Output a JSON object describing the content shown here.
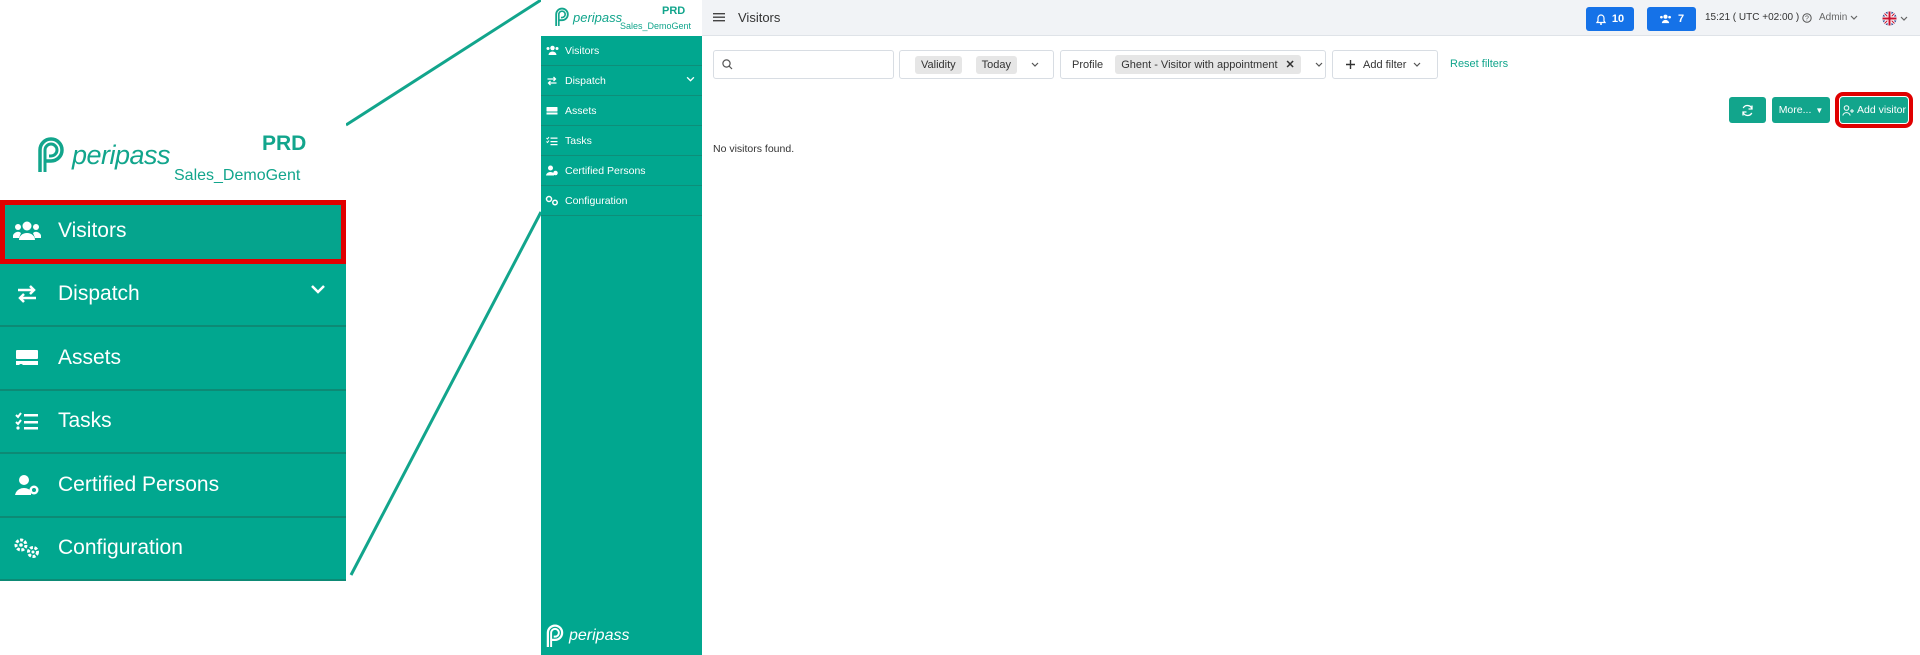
{
  "brand": {
    "name": "peripass",
    "env": "PRD",
    "tenant": "Sales_DemoGent"
  },
  "menu": [
    {
      "label": "Visitors",
      "icon": "users-icon"
    },
    {
      "label": "Dispatch",
      "icon": "transfer-icon",
      "has_children": true
    },
    {
      "label": "Assets",
      "icon": "truck-icon"
    },
    {
      "label": "Tasks",
      "icon": "tasks-icon"
    },
    {
      "label": "Certified Persons",
      "icon": "user-cert-icon"
    },
    {
      "label": "Configuration",
      "icon": "cogs-icon"
    }
  ],
  "header": {
    "title": "Visitors",
    "notifications_count": "10",
    "visitors_count": "7",
    "time": "15:21 ( UTC +02:00 )",
    "user": "Admin"
  },
  "filters": {
    "search_placeholder": "",
    "validity_label": "Validity",
    "validity_value": "Today",
    "profile_label": "Profile",
    "profile_value": "Ghent - Visitor with appointment",
    "add_filter": "Add filter",
    "reset": "Reset filters"
  },
  "toolbar": {
    "more_label": "More...",
    "add_label": "Add visitor"
  },
  "content": {
    "empty_message": "No visitors found."
  },
  "colors": {
    "primary": "#01a78f",
    "accent_blue": "#1572e8",
    "highlight": "#e00000"
  }
}
